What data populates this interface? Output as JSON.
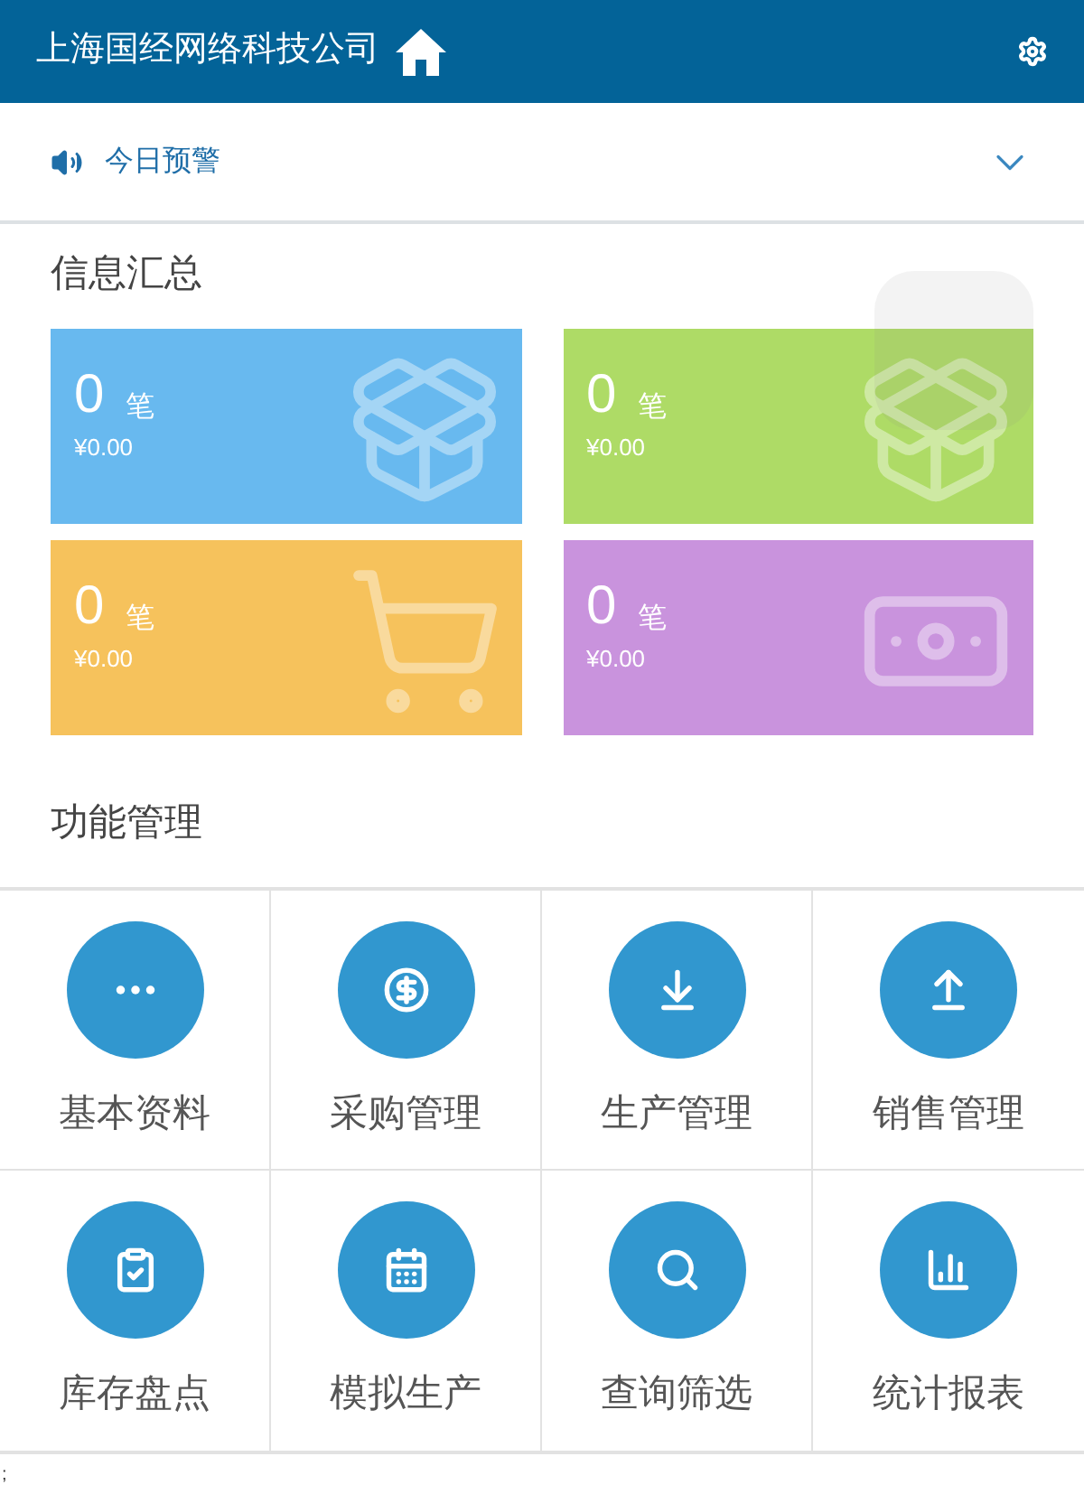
{
  "header": {
    "title": "上海国经网络科技公司"
  },
  "alert_bar": {
    "label": "今日预警"
  },
  "summary": {
    "title": "信息汇总",
    "cards": [
      {
        "count": "0",
        "unit": "笔",
        "amount": "¥0.00",
        "color": "#68b9ef"
      },
      {
        "count": "0",
        "unit": "笔",
        "amount": "¥0.00",
        "color": "#aedb66"
      },
      {
        "count": "0",
        "unit": "笔",
        "amount": "¥0.00",
        "color": "#f6c25c"
      },
      {
        "count": "0",
        "unit": "笔",
        "amount": "¥0.00",
        "color": "#c993dd"
      }
    ]
  },
  "functions": {
    "title": "功能管理",
    "items": [
      {
        "label": "基本资料"
      },
      {
        "label": "采购管理"
      },
      {
        "label": "生产管理"
      },
      {
        "label": "销售管理"
      },
      {
        "label": "库存盘点"
      },
      {
        "label": "模拟生产"
      },
      {
        "label": "查询筛选"
      },
      {
        "label": "统计报表"
      }
    ]
  },
  "footer_text": ";"
}
